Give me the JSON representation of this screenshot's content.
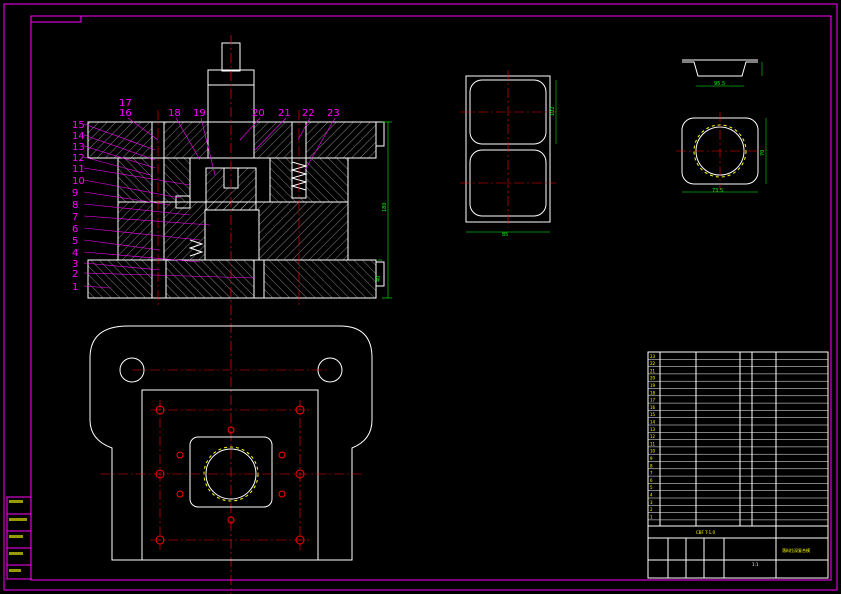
{
  "drawing": {
    "part_numbers": [
      "1",
      "2",
      "3",
      "4",
      "5",
      "6",
      "7",
      "8",
      "9",
      "10",
      "11",
      "12",
      "13",
      "14",
      "15",
      "16",
      "17",
      "18",
      "19",
      "20",
      "21",
      "22",
      "23"
    ],
    "dimensions": {
      "section_height": "180",
      "base_height": "40",
      "blank_height": "102",
      "blank_width": "85",
      "part_width": "73.5",
      "part_height": "70",
      "top_flange": "95.5"
    },
    "title_block": {
      "drawing_number": "CBF T-1.0",
      "title": "落料拉深复合模",
      "sheet": "1:1"
    },
    "colors": {
      "background": "#000000",
      "frame": "#ff00ff",
      "outline": "#ffffff",
      "centerline": "#ff0000",
      "dimension": "#00ff00",
      "hatch": "#ffffff",
      "table_text": "#ffff00"
    }
  }
}
